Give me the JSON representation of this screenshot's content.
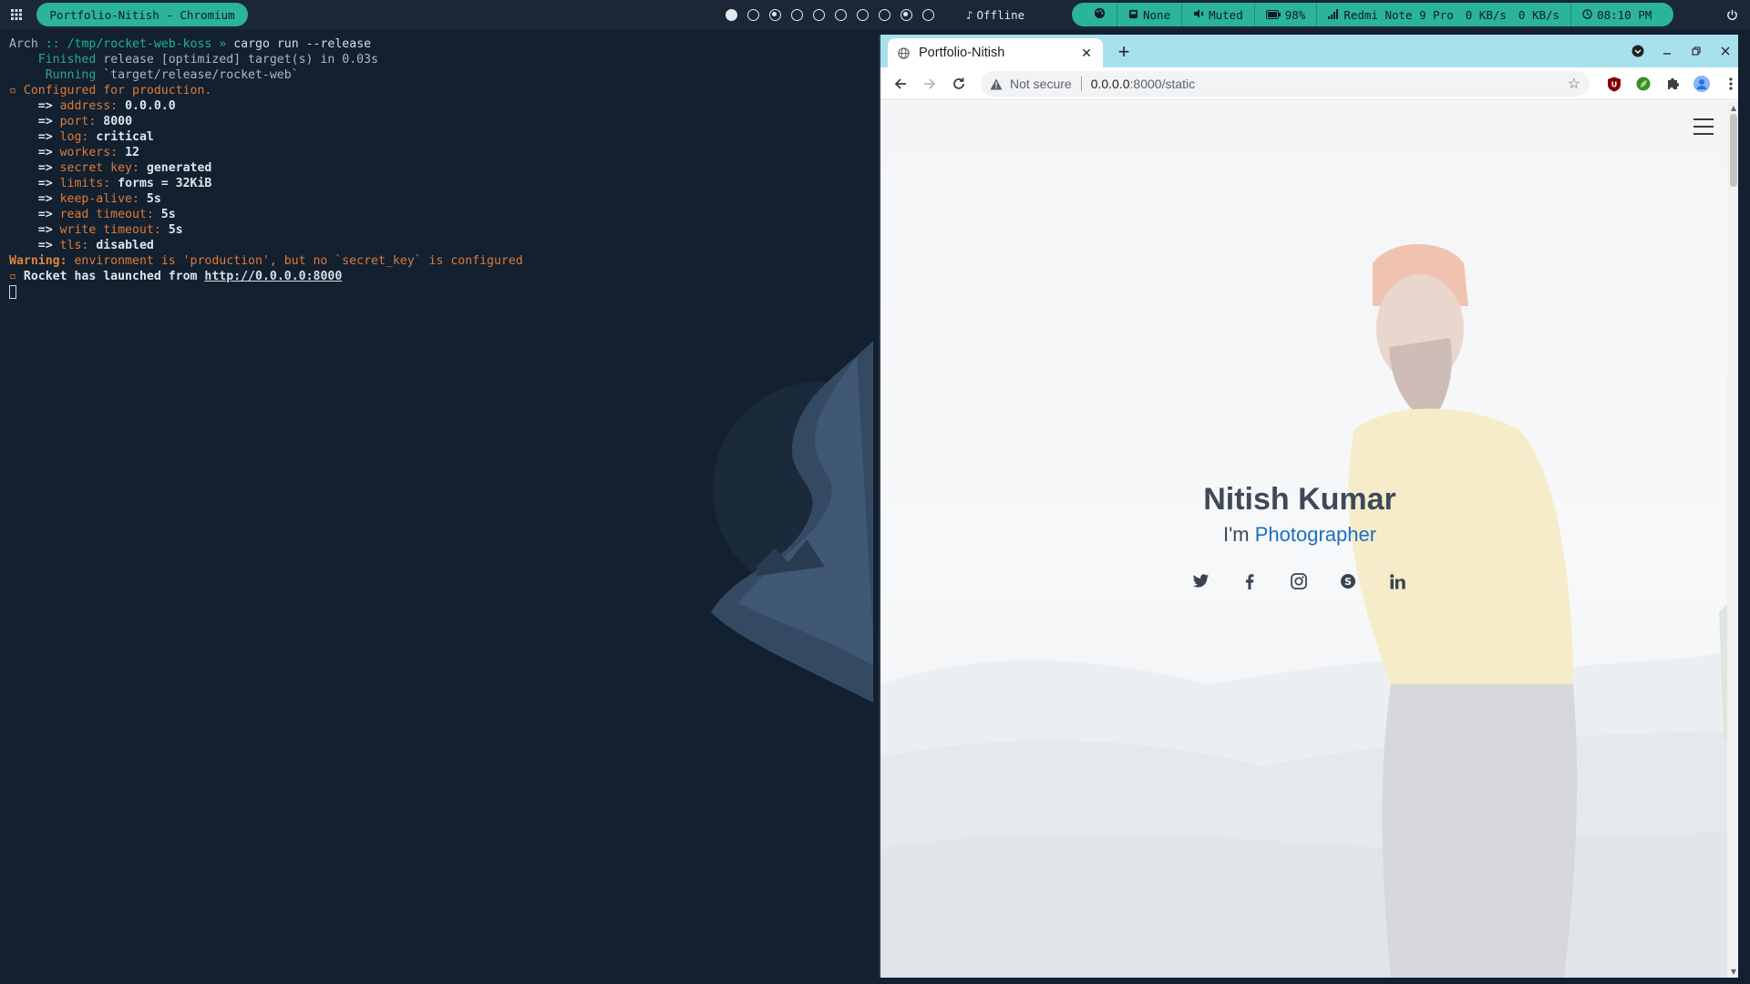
{
  "colors": {
    "accent": "#2bb39c",
    "terminal_bg": "#12202f",
    "link_blue": "#1e6fc2",
    "tabstrip": "#a9e0ee"
  },
  "topbar": {
    "active_window": "Portfolio-Nitish - Chromium",
    "workspaces": [
      "filled",
      "empty",
      "dot",
      "empty",
      "empty",
      "empty",
      "empty",
      "empty",
      "dot",
      "empty"
    ],
    "music": "Offline",
    "status": {
      "notifications": "None",
      "volume": "Muted",
      "battery": "98%",
      "network": "Redmi Note 9 Pro",
      "download": "0 KB/s",
      "upload": "0 KB/s",
      "clock": "08:10 PM"
    }
  },
  "terminal": {
    "prompt_host": "Arch",
    "prompt_sep": "::",
    "prompt_path": "/tmp/rocket-web-koss",
    "prompt_arrow": "»",
    "command": "cargo run --release",
    "finished_label": "Finished",
    "finished_text": "release [optimized] target(s) in 0.03s",
    "running_label": "Running",
    "running_text": "`target/release/rocket-web`",
    "configured": "Configured for production.",
    "config": [
      {
        "key": "address",
        "value": "0.0.0.0"
      },
      {
        "key": "port",
        "value": "8000"
      },
      {
        "key": "log",
        "value": "critical"
      },
      {
        "key": "workers",
        "value": "12"
      },
      {
        "key": "secret key",
        "value": "generated"
      },
      {
        "key": "limits",
        "value": "forms = 32KiB"
      },
      {
        "key": "keep-alive",
        "value": "5s"
      },
      {
        "key": "read timeout",
        "value": "5s"
      },
      {
        "key": "write timeout",
        "value": "5s"
      },
      {
        "key": "tls",
        "value": "disabled"
      }
    ],
    "warning_label": "Warning:",
    "warning_text": "environment is 'production', but no `secret_key` is configured",
    "launched_text": "Rocket has launched from",
    "launched_url": "http://0.0.0.0:8000"
  },
  "browser": {
    "tab_title": "Portfolio-Nitish",
    "new_tab": "+",
    "security_label": "Not secure",
    "url_host": "0.0.0.0",
    "url_path": ":8000/static",
    "page": {
      "name": "Nitish Kumar",
      "sub_prefix": "I'm ",
      "sub_role": "Photographer",
      "socials": [
        "twitter-icon",
        "facebook-icon",
        "instagram-icon",
        "skype-icon",
        "linkedin-icon"
      ]
    }
  }
}
